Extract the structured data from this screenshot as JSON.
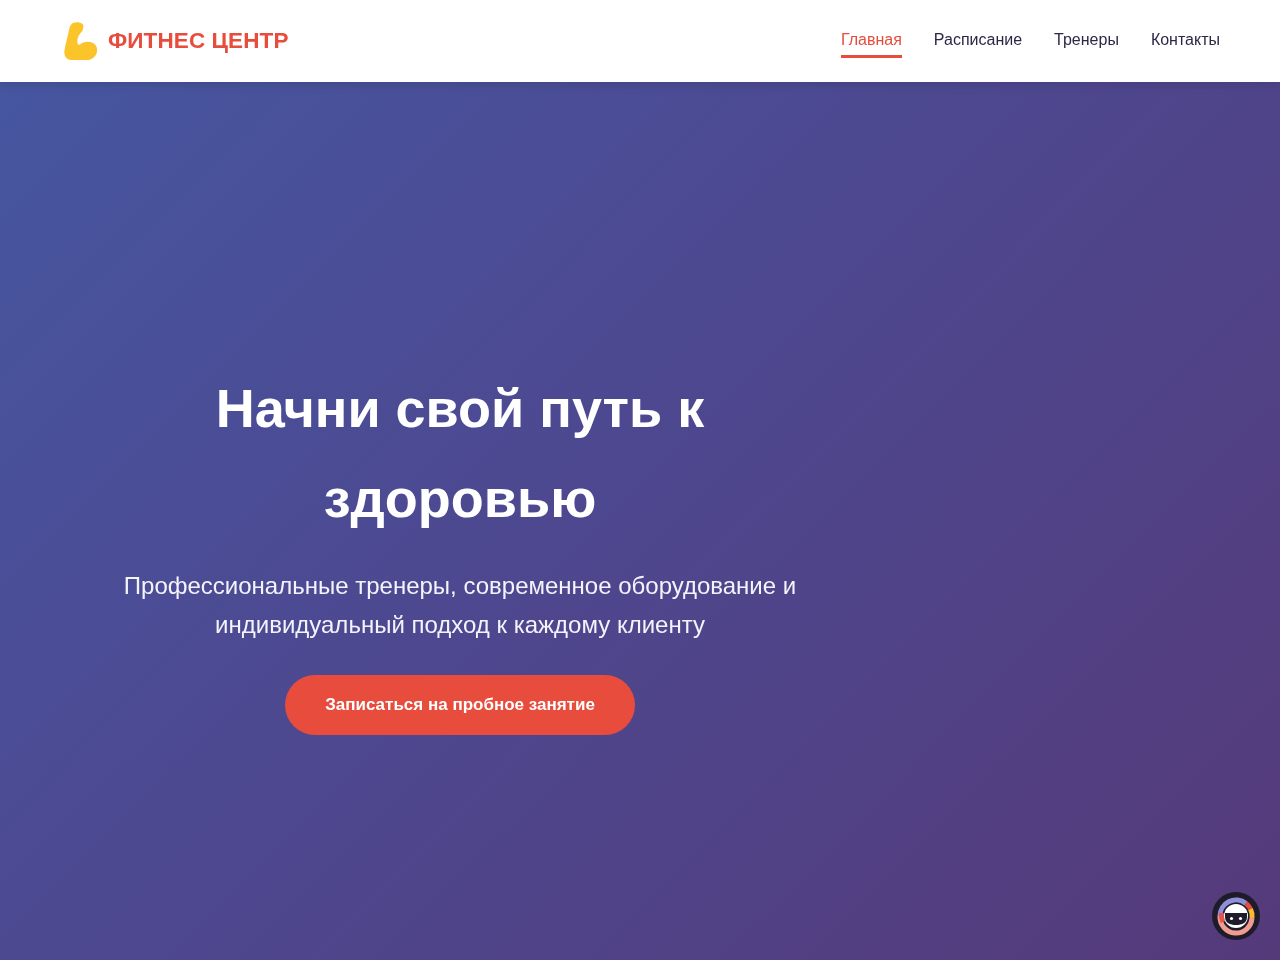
{
  "header": {
    "logo": {
      "text": "ФИТНЕС ЦЕНТР"
    },
    "nav": [
      {
        "label": "Главная",
        "selected": true
      },
      {
        "label": "Расписание",
        "selected": false
      },
      {
        "label": "Тренеры",
        "selected": false
      },
      {
        "label": "Контакты",
        "selected": false
      }
    ]
  },
  "hero": {
    "title": "Начни свой путь к здоровью",
    "subtitle": "Профессиональные тренеры, современное оборудование и индивидуальный подход к каждому клиенту",
    "button": "Записаться на пробное занятие"
  }
}
